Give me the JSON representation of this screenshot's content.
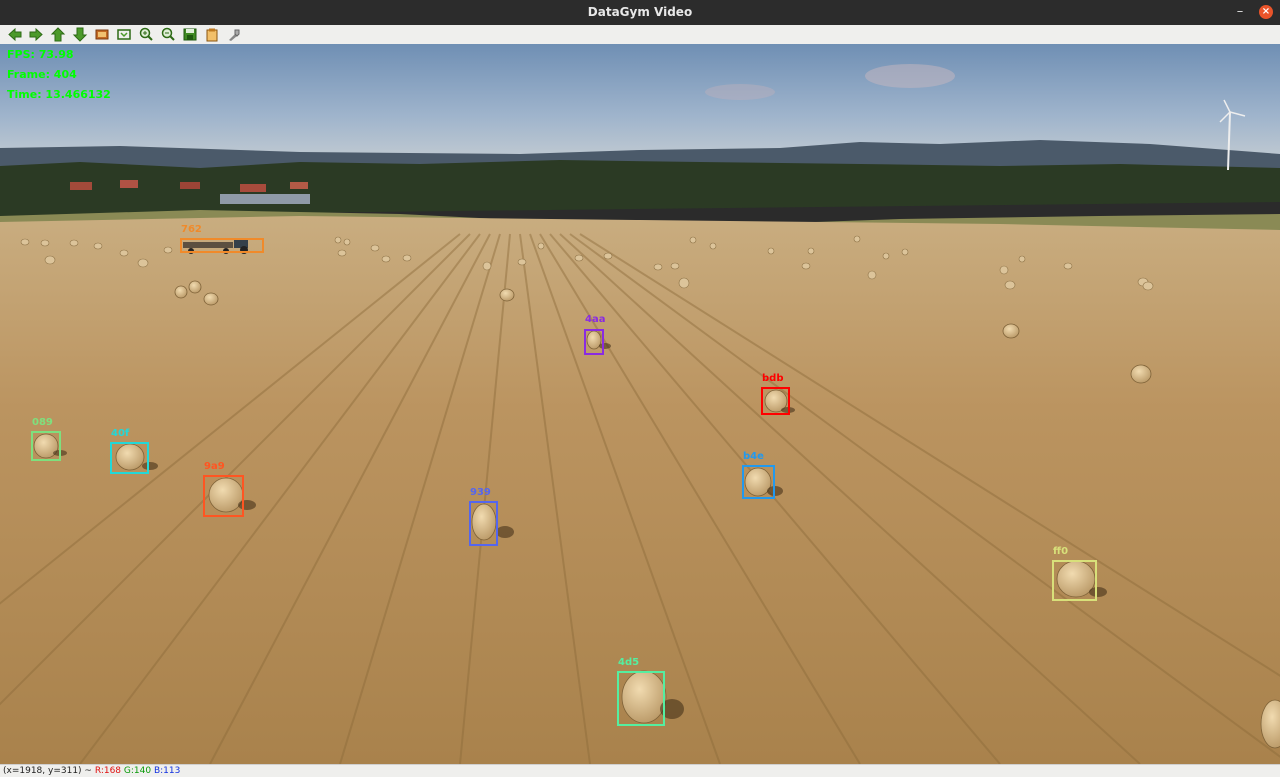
{
  "window": {
    "title": "DataGym Video",
    "minimize_glyph": "–",
    "close_glyph": "×"
  },
  "toolbar": {
    "buttons": [
      {
        "name": "back-arrow-icon",
        "color": "#3a8a1e"
      },
      {
        "name": "forward-arrow-icon",
        "color": "#3a8a1e"
      },
      {
        "name": "up-arrow-icon",
        "color": "#3a8a1e"
      },
      {
        "name": "down-arrow-icon",
        "color": "#3a8a1e"
      },
      {
        "name": "image-icon",
        "color": "#b8611d"
      },
      {
        "name": "fit-window-icon",
        "color": "#3a8a1e"
      },
      {
        "name": "zoom-in-icon",
        "color": "#2e6f18"
      },
      {
        "name": "zoom-out-icon",
        "color": "#2e6f18"
      },
      {
        "name": "save-icon",
        "color": "#2e6f18"
      },
      {
        "name": "clipboard-icon",
        "color": "#c07a20"
      },
      {
        "name": "properties-icon",
        "color": "#777777"
      }
    ]
  },
  "hud": {
    "fps": "FPS: 73.98",
    "frame": "Frame: 404",
    "time": "Time: 13.466132",
    "color": "#00ff00"
  },
  "detections": [
    {
      "id": "762",
      "color": "#f08a2a"
    },
    {
      "id": "4aa",
      "color": "#8a2be2"
    },
    {
      "id": "bdb",
      "color": "#ff0000"
    },
    {
      "id": "089",
      "color": "#7ee07e"
    },
    {
      "id": "40f",
      "color": "#22d8d8"
    },
    {
      "id": "9a9",
      "color": "#ff5522"
    },
    {
      "id": "939",
      "color": "#5566ee"
    },
    {
      "id": "b4e",
      "color": "#2299ee"
    },
    {
      "id": "ff0",
      "color": "#d8e07a"
    },
    {
      "id": "4d5",
      "color": "#55eea0"
    }
  ],
  "status": {
    "coords": "(x=1918, y=311) ~",
    "r": "R:168",
    "g": "G:140",
    "b": "B:113"
  }
}
